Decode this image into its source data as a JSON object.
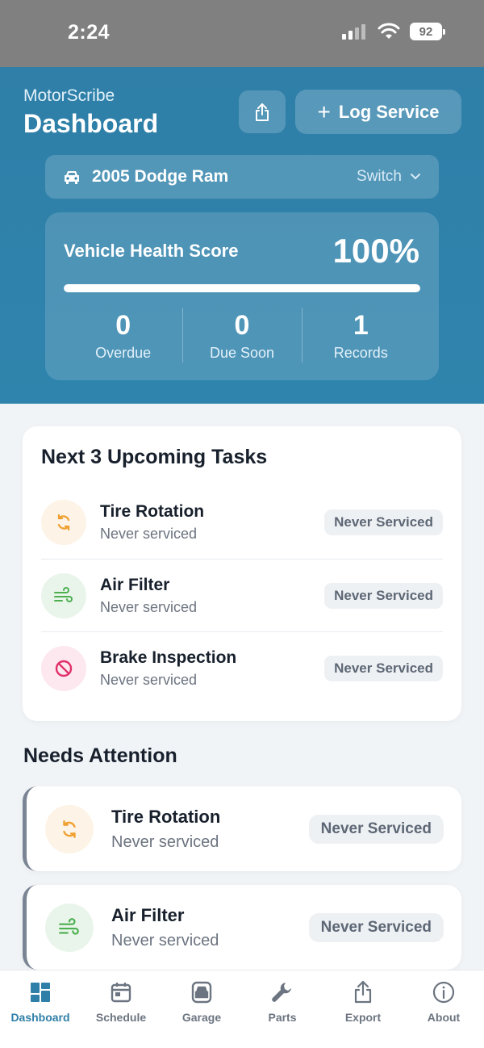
{
  "status_bar": {
    "time": "2:24",
    "battery": "92"
  },
  "header": {
    "app_name": "MotorScribe",
    "title": "Dashboard",
    "log_service_label": "Log Service"
  },
  "vehicle": {
    "name": "2005 Dodge Ram",
    "switch_label": "Switch"
  },
  "health": {
    "label": "Vehicle Health Score",
    "value": "100%",
    "fill_percent": 100,
    "stats": [
      {
        "value": "0",
        "label": "Overdue"
      },
      {
        "value": "0",
        "label": "Due Soon"
      },
      {
        "value": "1",
        "label": "Records"
      }
    ]
  },
  "upcoming": {
    "title": "Next 3 Upcoming Tasks",
    "tasks": [
      {
        "name": "Tire Rotation",
        "sub": "Never serviced",
        "badge": "Never Serviced",
        "icon": "rotate-icon"
      },
      {
        "name": "Air Filter",
        "sub": "Never serviced",
        "badge": "Never Serviced",
        "icon": "wind-icon"
      },
      {
        "name": "Brake Inspection",
        "sub": "Never serviced",
        "badge": "Never Serviced",
        "icon": "ban-icon"
      }
    ]
  },
  "attention": {
    "title": "Needs Attention",
    "items": [
      {
        "name": "Tire Rotation",
        "sub": "Never serviced",
        "badge": "Never Serviced",
        "icon": "rotate-icon"
      },
      {
        "name": "Air Filter",
        "sub": "Never serviced",
        "badge": "Never Serviced",
        "icon": "wind-icon"
      }
    ]
  },
  "tabs": [
    {
      "label": "Dashboard",
      "icon": "dashboard-icon",
      "active": true
    },
    {
      "label": "Schedule",
      "icon": "calendar-icon"
    },
    {
      "label": "Garage",
      "icon": "car-icon"
    },
    {
      "label": "Parts",
      "icon": "wrench-icon"
    },
    {
      "label": "Export",
      "icon": "share-icon"
    },
    {
      "label": "About",
      "icon": "info-icon"
    }
  ],
  "colors": {
    "accent": "#2f7fa8",
    "rotate": "#f0a030",
    "wind": "#4caf50",
    "brake": "#e0306a"
  }
}
